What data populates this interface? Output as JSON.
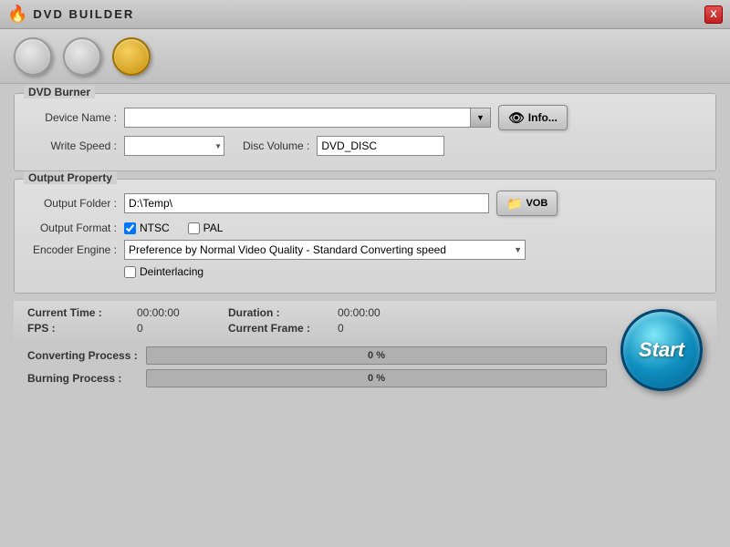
{
  "titleBar": {
    "title": "DVD BUILDER",
    "closeLabel": "X"
  },
  "toolbar": {
    "btn1": "",
    "btn2": "",
    "btn3": ""
  },
  "dvdBurner": {
    "groupTitle": "DVD Burner",
    "deviceNameLabel": "Device Name :",
    "deviceNameValue": "",
    "infoLabel": "Info...",
    "writeSpeedLabel": "Write Speed :",
    "writeSpeedValue": "",
    "discVolumeLabel": "Disc Volume :",
    "discVolumeValue": "DVD_DISC"
  },
  "outputProperty": {
    "groupTitle": "Output Property",
    "outputFolderLabel": "Output Folder :",
    "outputFolderValue": "D:\\Temp\\",
    "vobLabel": "VOB",
    "outputFormatLabel": "Output Format :",
    "ntscLabel": "NTSC",
    "palLabel": "PAL",
    "encoderEngineLabel": "Encoder Engine :",
    "encoderEngineValue": "Preference by Normal Video Quality - Standard Converting speed",
    "deinterlacingLabel": "Deinterlacing"
  },
  "statusInfo": {
    "currentTimeLabel": "Current Time :",
    "currentTimeValue": "00:00:00",
    "durationLabel": "Duration :",
    "durationValue": "00:00:00",
    "fpsLabel": "FPS :",
    "fpsValue": "0",
    "currentFrameLabel": "Current Frame :",
    "currentFrameValue": "0"
  },
  "progress": {
    "convertingLabel": "Converting Process :",
    "convertingPercent": "0 %",
    "burningLabel": "Burning Process :",
    "burningPercent": "0 %"
  },
  "startButton": {
    "label": "Start"
  }
}
